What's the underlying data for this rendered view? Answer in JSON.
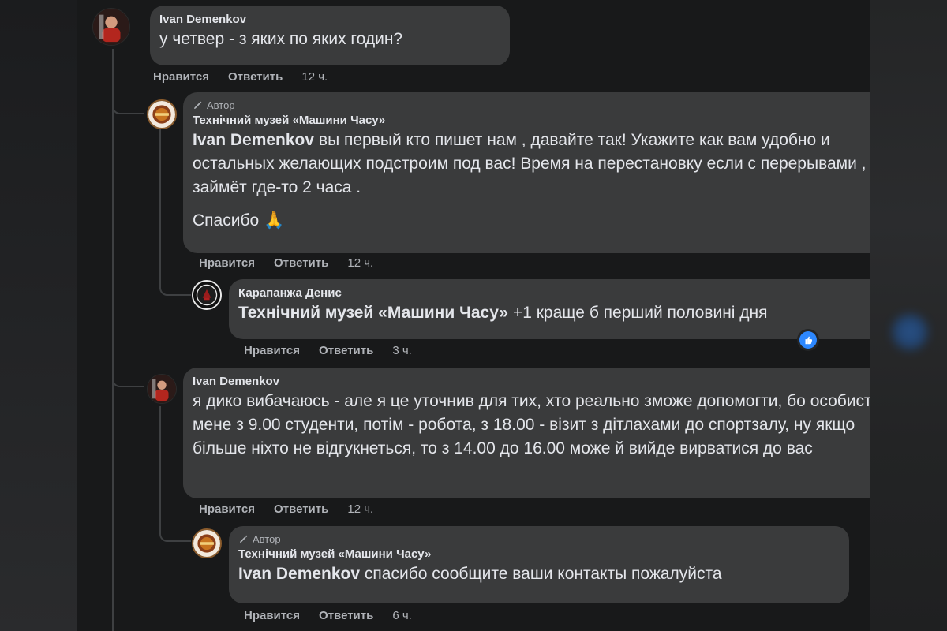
{
  "comments": [
    {
      "author": "Ivan Demenkov",
      "text": "у четвер - з яких по яких годин?",
      "actions": {
        "like": "Нравится",
        "reply": "Ответить",
        "time": "12 ч."
      }
    },
    {
      "badge": "Автор",
      "author": "Технічний музей «Машини Часу»",
      "mention": "Ivan Demenkov",
      "text": " вы первый кто пишет нам , давайте так! Укажите как вам удобно и остальных желающих подстроим под вас! Время на перестановку если с перерывами , займёт где-то 2 часа .",
      "text2": "Спасибо 🙏",
      "actions": {
        "like": "Нравится",
        "reply": "Ответить",
        "time": "12 ч."
      }
    },
    {
      "author": "Карапанжа Денис",
      "mention": "Технічний музей «Машини Часу»",
      "text": " +1 краще б перший половині дня",
      "actions": {
        "like": "Нравится",
        "reply": "Ответить",
        "time": "3 ч."
      },
      "reaction_icon": "like-reaction-icon"
    },
    {
      "author": "Ivan Demenkov",
      "text": "я дико вибачаюсь - але я це уточнив для тих, хто реально зможе допомогти, бо особисто в мене з 9.00 студенти, потім - робота, з 18.00 - візит з дітлахами до спортзалу, ну якщо більше ніхто не відгукнеться, то з 14.00 до 16.00 може й вийде вирватися до вас",
      "actions": {
        "like": "Нравится",
        "reply": "Ответить",
        "time": "12 ч."
      }
    },
    {
      "badge": "Автор",
      "author": "Технічний музей «Машини Часу»",
      "mention": "Ivan Demenkov",
      "text": " спасибо сообщите ваши контакты пожалуйста",
      "actions": {
        "like": "Нравится",
        "reply": "Ответить",
        "time": "6 ч."
      }
    }
  ],
  "colors": {
    "background": "#18191a",
    "bubble": "#3a3b3c",
    "secondary_text": "#b0b3b8",
    "primary_text": "#e4e6eb",
    "accent": "#2d88ff"
  },
  "icons": {
    "author_badge": "pencil-icon",
    "reaction": "thumbs-up-icon"
  }
}
